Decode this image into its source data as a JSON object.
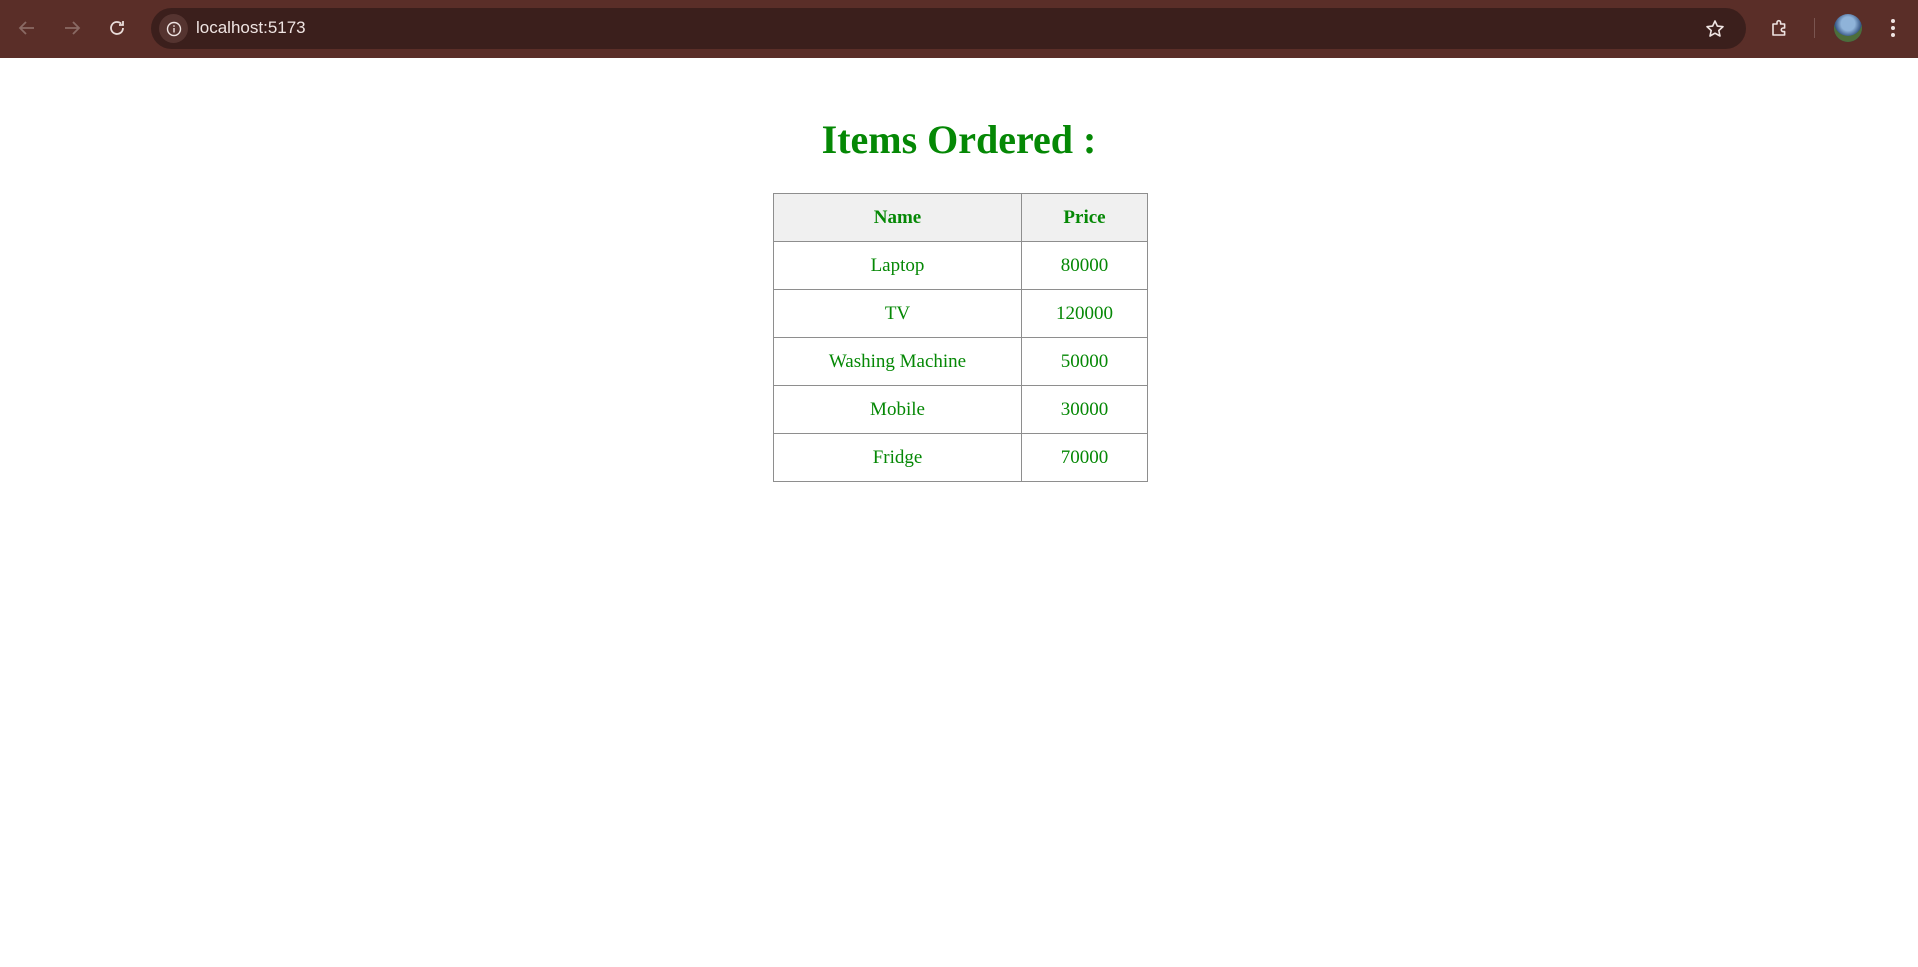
{
  "browser": {
    "url": "localhost:5173",
    "icons": {
      "back": "back-arrow-icon",
      "forward": "forward-arrow-icon",
      "reload": "reload-icon",
      "site_info": "info-icon",
      "bookmark": "star-icon",
      "extensions": "puzzle-icon",
      "profile": "avatar",
      "menu": "kebab-menu-icon"
    }
  },
  "page": {
    "title": "Items Ordered :",
    "accent_color": "#058805",
    "table": {
      "headers": [
        "Name",
        "Price"
      ],
      "rows": [
        {
          "name": "Laptop",
          "price": "80000"
        },
        {
          "name": "TV",
          "price": "120000"
        },
        {
          "name": "Washing Machine",
          "price": "50000"
        },
        {
          "name": "Mobile",
          "price": "30000"
        },
        {
          "name": "Fridge",
          "price": "70000"
        }
      ]
    }
  }
}
